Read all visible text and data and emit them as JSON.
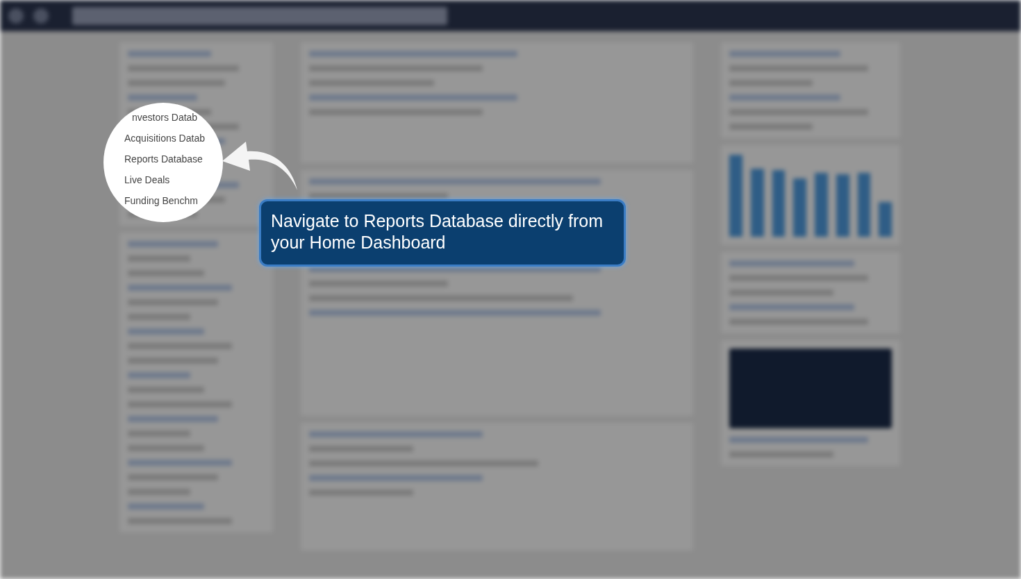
{
  "magnifier": {
    "items": [
      {
        "label": "nvestors Datab"
      },
      {
        "label": "Acquisitions Datab"
      },
      {
        "label": "Reports Database"
      },
      {
        "label": "Live Deals"
      },
      {
        "label": "Funding Benchm"
      }
    ]
  },
  "callout": {
    "text": "Navigate to Reports Database directly from your Home Dashboard"
  }
}
